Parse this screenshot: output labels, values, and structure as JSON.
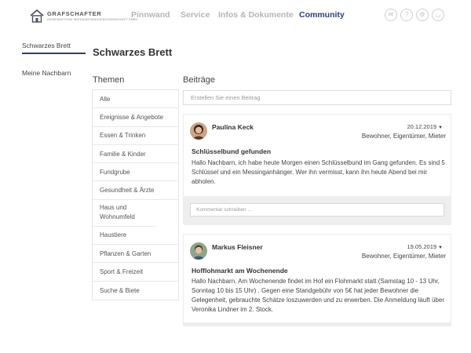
{
  "logo": {
    "name": "GRAFSCHAFTER",
    "sub": "GEMEINNÜTZIGE WOHNUNGSBAUGENOSSENSCHAFT GMBH"
  },
  "nav": {
    "items": [
      {
        "label": "Pinnwand"
      },
      {
        "label": "Service"
      },
      {
        "label": "Infos & Dokumente"
      },
      {
        "label": "Community"
      }
    ],
    "active": "Community"
  },
  "header_icons": [
    "mail-icon",
    "help-icon",
    "settings-icon",
    "user-icon"
  ],
  "sidebar": {
    "items": [
      {
        "label": "Schwarzes Brett"
      },
      {
        "label": "Meine Nachbarn"
      }
    ]
  },
  "page": {
    "title": "Schwarzes Brett"
  },
  "topics": {
    "title": "Themen",
    "items": [
      "Alle",
      "Ereignisse & Angebote",
      "Essen & Trinken",
      "Familie & Kinder",
      "Fundgrube",
      "Gesundheit & Ärzte",
      "Haus und Wohnumfeld",
      "Haustiere",
      "Pflanzen & Garten",
      "Sport & Freizeit",
      "Suche & Biete"
    ]
  },
  "posts": {
    "title": "Beiträge",
    "new_placeholder": "Erstellen Sie einen Beitrag",
    "comment_placeholder": "Kommentar schreiben ...",
    "items": [
      {
        "author": "Paulina Keck",
        "date": "20.12.2019",
        "roles": "Bewohner, Eigentümer, Mieter",
        "title": "Schlüsselbund gefunden",
        "text": "Hallo Nachbarn, ich habe heute Morgen einen Schlüsselbund im Gang gefunden. Es sind 5 Schlüssel und ein Messinganhänger. Wer ihn vermisst, kann ihn heute Abend bei mir abholen."
      },
      {
        "author": "Markus Fleisner",
        "date": "19.05.2019",
        "roles": "Bewohner, Eigentümer, Mieter",
        "title": "Hofflohmarkt am Wochenende",
        "text": "Hallo Nachbarn. Am Wochenende findet im Hof ein Flohmarkt statt (Samstag 10 - 13 Uhr, Sonntag 10 bis 15 Uhr) . Gegen eine Standgebühr von 5€ hat jeder Bewohner die Gelegenheit, gebrauchte Schätze loszuwerden und zu erwerben. Die Anmeldung läuft über Veronika Lindner im 2. Stock."
      }
    ]
  },
  "colors": {
    "accent": "#2c3f75",
    "nav_inactive": "#b5b5b5",
    "comment_bg": "#eeeeee"
  }
}
